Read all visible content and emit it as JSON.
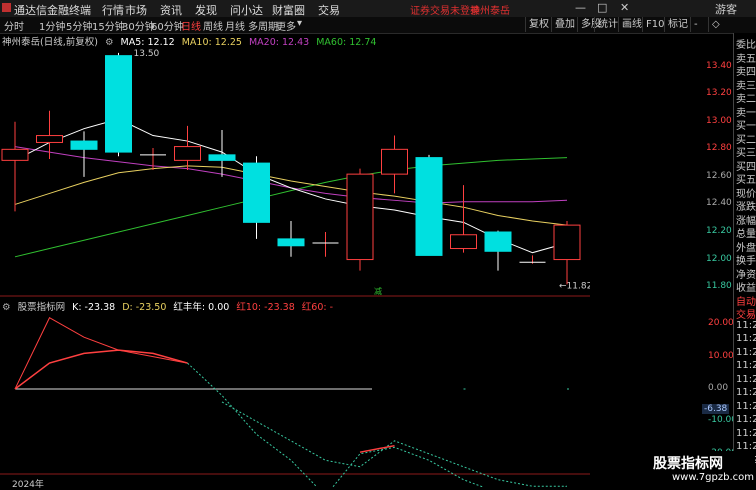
{
  "titlebar": {
    "app_title": "通达信金融终端",
    "menus": [
      "行情",
      "市场",
      "资讯",
      "发现",
      "问小达",
      "财富圈",
      "交易"
    ],
    "warning": "证券交易未登录",
    "stock_name": "神州泰岳",
    "user": "游客"
  },
  "toolbar": {
    "periods": [
      "分时",
      "1分钟",
      "5分钟",
      "15分钟",
      "30分钟",
      "60分钟",
      "日线",
      "周线",
      "月线",
      "多周期",
      "更多"
    ],
    "active_period": "日线",
    "right_buttons": [
      "复权",
      "叠加",
      "多股",
      "统计",
      "画线",
      "F10",
      "标记",
      "-",
      "◇"
    ]
  },
  "legend_top": {
    "name": "神州泰岳(日线,前复权)",
    "ma5": "MA5: 12.12",
    "ma10": "MA10: 12.25",
    "ma20": "MA20: 12.43",
    "ma60": "MA60: 12.74",
    "max_label": "13.50",
    "min_label": "←11.82",
    "rebate_label": "减"
  },
  "legend_bot": {
    "name": "股票指标网",
    "k": "K: -23.38",
    "d": "D: -23.50",
    "red_year": "红丰年: 0.00",
    "red10": "红10: -23.38",
    "red60": "红60: -"
  },
  "price_axis": [
    "13.40",
    "13.20",
    "13.00",
    "12.80",
    "12.60",
    "12.40",
    "12.20",
    "12.00",
    "11.80"
  ],
  "ind_axis": [
    "20.00",
    "10.00",
    "0.00",
    "-6.38",
    "-10.00",
    "-20.00"
  ],
  "side_panel": [
    "委比",
    "卖五",
    "卖四",
    "卖三",
    "卖二",
    "卖一",
    "买一",
    "买二",
    "买三",
    "买四",
    "买五",
    "现价",
    "涨跌",
    "涨幅",
    "总量",
    "外盘",
    "换手",
    "净资",
    "收益",
    "自动",
    "交易",
    "11:2",
    "11:2",
    "11:2",
    "11:2",
    "11:2",
    "11:2",
    "11:2",
    "11:2",
    "11:2",
    "11:2",
    "11:2"
  ],
  "year_label": "2024年",
  "watermark": {
    "line1": "股票指标网",
    "line2": "www.7gpzb.com"
  },
  "colors": {
    "up": "#ff4040",
    "down": "#00e0e0",
    "ma5": "#ffffff",
    "ma10": "#e8d060",
    "ma20": "#c040c0",
    "ma60": "#30c030"
  },
  "chart_data": {
    "type": "candlestick",
    "candles": [
      {
        "o": 12.72,
        "h": 13.0,
        "l": 12.35,
        "c": 12.8
      },
      {
        "o": 12.85,
        "h": 13.08,
        "l": 12.73,
        "c": 12.9
      },
      {
        "o": 12.86,
        "h": 12.93,
        "l": 12.6,
        "c": 12.8
      },
      {
        "o": 13.48,
        "h": 13.5,
        "l": 12.75,
        "c": 12.78
      },
      {
        "o": 12.76,
        "h": 12.81,
        "l": 12.65,
        "c": 12.76
      },
      {
        "o": 12.72,
        "h": 12.97,
        "l": 12.65,
        "c": 12.82
      },
      {
        "o": 12.76,
        "h": 12.94,
        "l": 12.6,
        "c": 12.72
      },
      {
        "o": 12.7,
        "h": 12.75,
        "l": 12.15,
        "c": 12.27
      },
      {
        "o": 12.15,
        "h": 12.28,
        "l": 12.02,
        "c": 12.1
      },
      {
        "o": 12.12,
        "h": 12.2,
        "l": 12.02,
        "c": 12.12
      },
      {
        "o": 12.0,
        "h": 12.66,
        "l": 11.92,
        "c": 12.62
      },
      {
        "o": 12.62,
        "h": 12.9,
        "l": 12.48,
        "c": 12.8
      },
      {
        "o": 12.74,
        "h": 12.76,
        "l": 12.03,
        "c": 12.03
      },
      {
        "o": 12.08,
        "h": 12.54,
        "l": 12.05,
        "c": 12.18
      },
      {
        "o": 12.2,
        "h": 12.21,
        "l": 11.92,
        "c": 12.06
      },
      {
        "o": 11.98,
        "h": 12.03,
        "l": 11.97,
        "c": 11.98
      },
      {
        "o": 12.0,
        "h": 12.28,
        "l": 11.82,
        "c": 12.25
      }
    ],
    "ma5": [
      12.72,
      12.85,
      12.95,
      13.02,
      12.9,
      12.86,
      12.78,
      12.62,
      12.52,
      12.44,
      12.39,
      12.36,
      12.31,
      12.27,
      12.15,
      12.05,
      12.12
    ],
    "ma10": [
      12.4,
      12.48,
      12.56,
      12.63,
      12.66,
      12.68,
      12.67,
      12.62,
      12.57,
      12.53,
      12.49,
      12.46,
      12.42,
      12.38,
      12.32,
      12.28,
      12.25
    ],
    "ma20": [
      12.82,
      12.78,
      12.74,
      12.71,
      12.68,
      12.66,
      12.62,
      12.57,
      12.52,
      12.48,
      12.45,
      12.43,
      12.41,
      12.42,
      12.42,
      12.42,
      12.43
    ],
    "ma60": [
      12.02,
      12.08,
      12.14,
      12.2,
      12.26,
      12.32,
      12.38,
      12.44,
      12.5,
      12.56,
      12.61,
      12.65,
      12.68,
      12.7,
      12.72,
      12.73,
      12.74
    ],
    "indicator": {
      "red_solid": [
        0.0,
        8.0,
        11.0,
        12.0,
        11.0,
        8.0
      ],
      "red_segment": [
        -19.5,
        -17.5
      ],
      "green_dashed": [
        null,
        null,
        null,
        null,
        null,
        8.0,
        -2.0,
        -14.0,
        -22.0,
        -33.0,
        -20.0,
        -18.0,
        -22.0,
        -28.0,
        -32.0,
        -36.0,
        -30.0
      ],
      "green_dashed2": [
        null,
        null,
        null,
        null,
        null,
        null,
        -4.0,
        -10.0,
        -16.0,
        -22.0,
        -24.0,
        -16.0,
        -20.0,
        -24.0,
        -28.0,
        -30.0,
        -30.0
      ],
      "zero_line_end_index": 10
    },
    "price_range": [
      11.75,
      13.55
    ],
    "ind_range": [
      -25.0,
      25.0
    ]
  }
}
